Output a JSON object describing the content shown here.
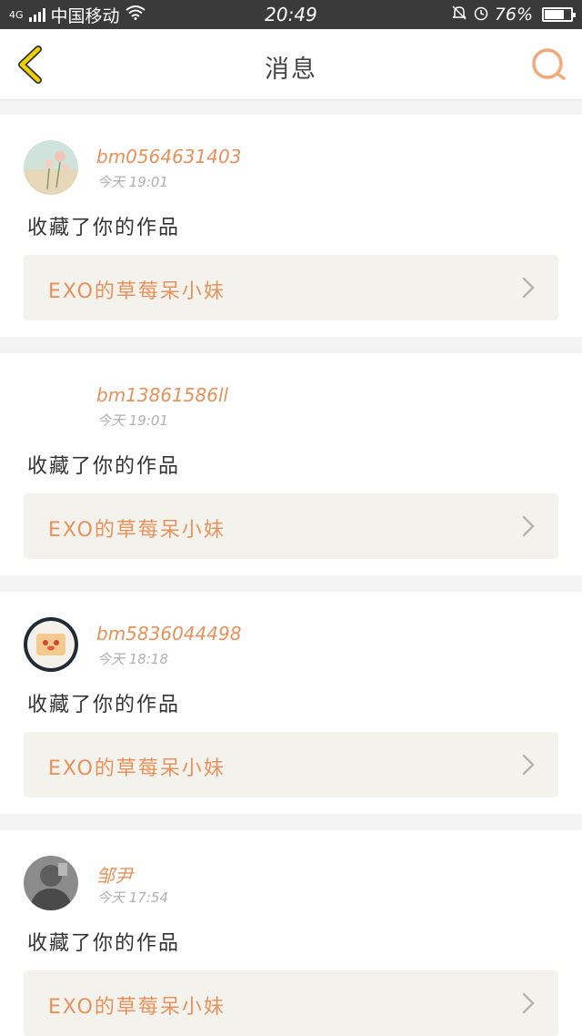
{
  "status_bar": {
    "network": "4G",
    "carrier": "中国移动",
    "time": "20:49",
    "battery_percent": "76%",
    "battery_level": 0.76,
    "icons": [
      "signal-icon",
      "wifi-icon",
      "bell-off-icon",
      "alarm-icon",
      "battery-icon"
    ]
  },
  "header": {
    "title": "消息",
    "back_icon": "chevron-left-icon",
    "search_icon": "search-icon",
    "accent_back": "#f0d000",
    "accent_search": "#f2a877"
  },
  "messages": [
    {
      "username": "bm0564631403",
      "time": "今天 19:01",
      "action": "收藏了你的作品",
      "work": "EXO的草莓呆小妹",
      "avatar": "flower-avatar"
    },
    {
      "username": "bm13861586ll",
      "time": "今天 19:01",
      "action": "收藏了你的作品",
      "work": "EXO的草莓呆小妹",
      "avatar": "blank-avatar"
    },
    {
      "username": "bm5836044498",
      "time": "今天 18:18",
      "action": "收藏了你的作品",
      "work": "EXO的草莓呆小妹",
      "avatar": "toast-avatar"
    },
    {
      "username": "邹尹",
      "time": "今天 17:54",
      "action": "收藏了你的作品",
      "work": "EXO的草莓呆小妹",
      "avatar": "photo-avatar"
    }
  ],
  "colors": {
    "accent": "#e8915a",
    "status_bar_bg": "#3a3a3a",
    "work_bg": "#f3f2ed"
  }
}
